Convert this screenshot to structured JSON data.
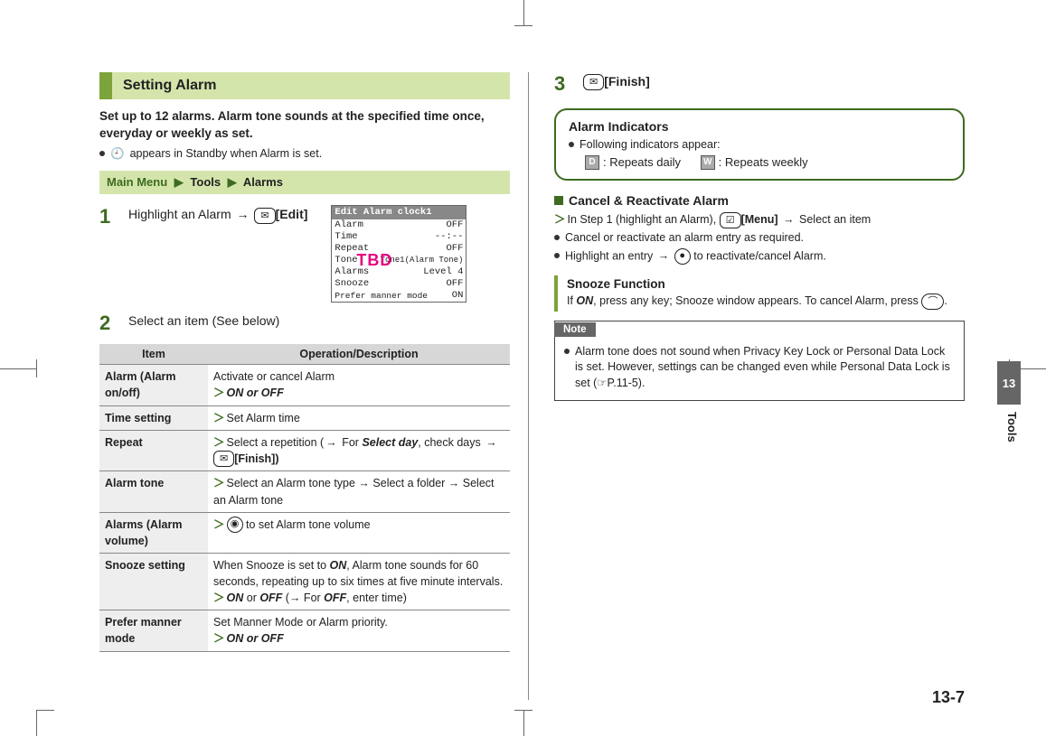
{
  "left": {
    "heading": "Setting Alarm",
    "intro": "Set up to 12 alarms. Alarm tone sounds at the specified time once, everyday or weekly as set.",
    "standby_note_pre": "",
    "standby_note": "appears in Standby when Alarm is set.",
    "menu_path": {
      "root": "Main Menu",
      "l1": "Tools",
      "l2": "Alarms"
    },
    "step1": {
      "text": "Highlight an Alarm",
      "key": "✉",
      "action": "[Edit]"
    },
    "phone": {
      "title": "Edit Alarm clock1",
      "rows": [
        {
          "l": "Alarm",
          "r": "OFF"
        },
        {
          "l": "Time",
          "r": "--:--"
        },
        {
          "l": "Repeat",
          "r": "OFF"
        },
        {
          "l": "Tone",
          "r": "Tone1(Alarm Tone)"
        },
        {
          "l": "Alarms",
          "r": "Level 4"
        },
        {
          "l": "Snooze",
          "r": "OFF"
        },
        {
          "l": "Prefer manner mode",
          "r": "ON"
        }
      ],
      "overlay": "TBD"
    },
    "step2": "Select an item (See below)",
    "table": {
      "headers": [
        "Item",
        "Operation/Description"
      ],
      "rows": [
        {
          "item": "Alarm (Alarm on/off)",
          "desc_pre": "Activate or cancel Alarm",
          "desc_opt": "ON or OFF"
        },
        {
          "item": "Time setting",
          "desc_opt": "Set Alarm time"
        },
        {
          "item": "Repeat",
          "desc_opt_pre": "Select a repetition (",
          "desc_opt_mid": "For Select day, check days",
          "desc_opt_key": "✉",
          "desc_opt_post": "[Finish])"
        },
        {
          "item": "Alarm tone",
          "desc_opt": "Select an Alarm tone type → Select a folder → Select an Alarm tone"
        },
        {
          "item": "Alarms (Alarm volume)",
          "desc_opt_icon": "◉",
          "desc_opt": "to set Alarm tone volume"
        },
        {
          "item": "Snooze setting",
          "desc_pre": "When Snooze is set to ON, Alarm tone sounds for 60 seconds, repeating up to six times at five minute intervals.",
          "desc_opt": "ON or OFF (→ For OFF, enter time)"
        },
        {
          "item": "Prefer manner mode",
          "desc_pre": "Set Manner Mode or Alarm priority.",
          "desc_opt": "ON or OFF"
        }
      ]
    }
  },
  "right": {
    "step3": {
      "key": "✉",
      "action": "[Finish]"
    },
    "indicators": {
      "title": "Alarm Indicators",
      "lead": "Following indicators appear:",
      "d": "D",
      "d_label": ": Repeats daily",
      "w": "W",
      "w_label": ": Repeats weekly"
    },
    "cancel": {
      "title": "Cancel & Reactivate Alarm",
      "line1_pre": "In Step 1 (highlight an Alarm),",
      "line1_key": "☑",
      "line1_menu": "[Menu]",
      "line1_post": "Select an item",
      "line2": "Cancel or reactivate an alarm entry as required.",
      "line3_pre": "Highlight an entry",
      "line3_post": "to reactivate/cancel Alarm."
    },
    "snooze": {
      "title": "Snooze Function",
      "body_pre": "If ON, press any key; Snooze window appears. To cancel Alarm, press"
    },
    "note": {
      "label": "Note",
      "body": "Alarm tone does not sound when Privacy Key Lock or Personal Data Lock is set. However, settings can be changed even while Personal Data Lock is set (☞P.11-5)."
    },
    "chapter": "13",
    "chapter_label": "Tools",
    "page_number": "13-7"
  }
}
